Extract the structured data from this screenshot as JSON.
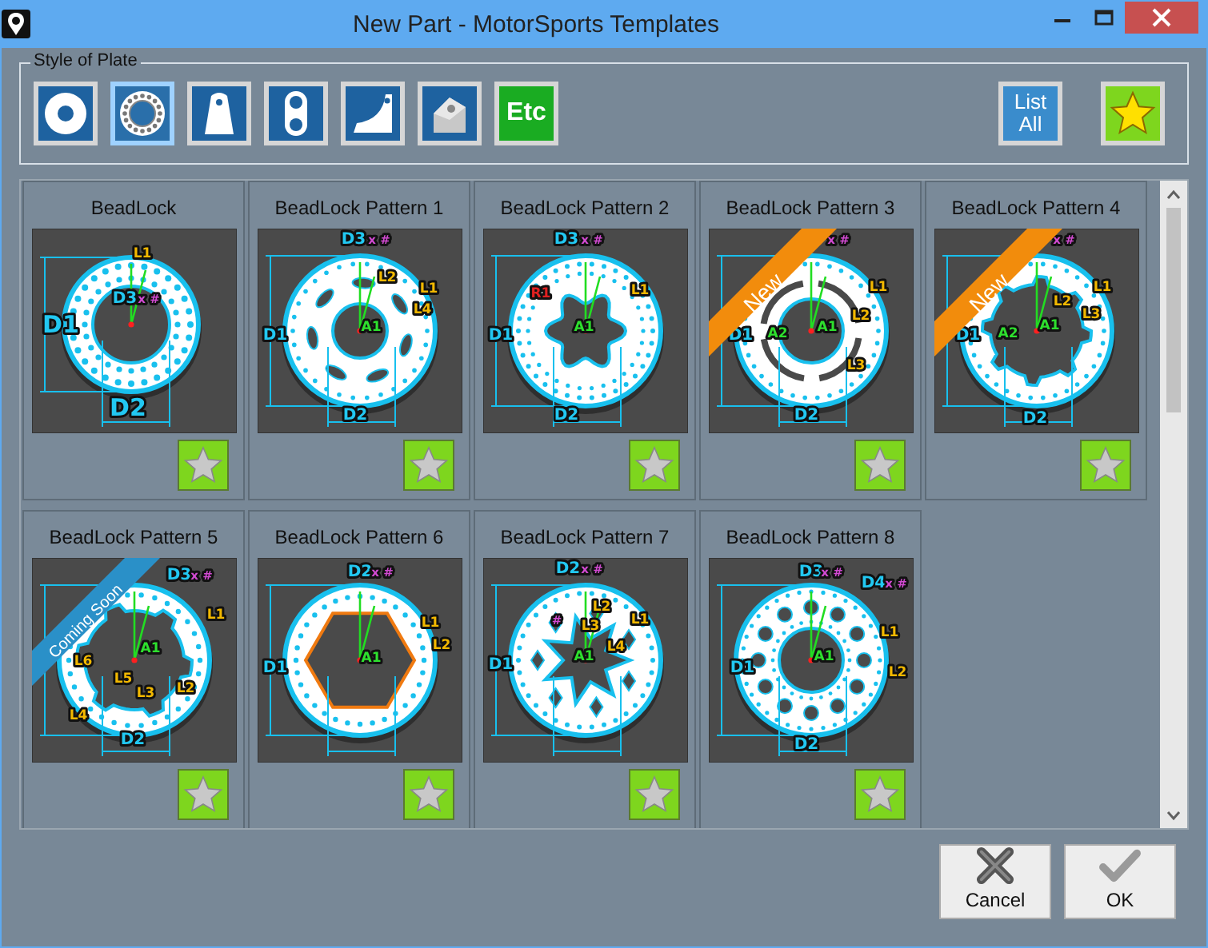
{
  "window": {
    "title": "New Part - MotorSports Templates"
  },
  "plate_style": {
    "label": "Style of Plate",
    "options": [
      {
        "kind": "washer",
        "selected": false
      },
      {
        "kind": "beadlock",
        "selected": true
      },
      {
        "kind": "tab",
        "selected": false
      },
      {
        "kind": "link",
        "selected": false
      },
      {
        "kind": "gusset",
        "selected": false
      },
      {
        "kind": "mount",
        "selected": false
      },
      {
        "kind": "text",
        "text": "Etc",
        "selected": false
      }
    ],
    "list_all": "List All"
  },
  "templates": [
    {
      "title": "BeadLock",
      "kind": "plain",
      "favorite": false,
      "labels": [
        {
          "text": "L1",
          "kind": "length"
        },
        {
          "text": "D3",
          "kind": "diameter"
        },
        {
          "text": "x #",
          "kind": "count"
        },
        {
          "text": "D1",
          "kind": "diameter"
        },
        {
          "text": "D2",
          "kind": "diameter"
        }
      ]
    },
    {
      "title": "BeadLock Pattern 1",
      "kind": "slots",
      "favorite": false,
      "labels": [
        {
          "text": "D3",
          "kind": "diameter"
        },
        {
          "text": "x #",
          "kind": "count"
        },
        {
          "text": "L2",
          "kind": "length"
        },
        {
          "text": "L1",
          "kind": "length"
        },
        {
          "text": "L4",
          "kind": "length"
        },
        {
          "text": "D1",
          "kind": "diameter"
        },
        {
          "text": "A1",
          "kind": "angle"
        },
        {
          "text": "D2",
          "kind": "diameter"
        }
      ]
    },
    {
      "title": "BeadLock Pattern 2",
      "kind": "lobes",
      "favorite": false,
      "labels": [
        {
          "text": "D3",
          "kind": "diameter"
        },
        {
          "text": "x #",
          "kind": "count"
        },
        {
          "text": "R1",
          "kind": "radius"
        },
        {
          "text": "L1",
          "kind": "length"
        },
        {
          "text": "D1",
          "kind": "diameter"
        },
        {
          "text": "A1",
          "kind": "angle"
        },
        {
          "text": "D2",
          "kind": "diameter"
        }
      ]
    },
    {
      "title": "BeadLock Pattern 3",
      "kind": "split",
      "favorite": false,
      "ribbon": {
        "kind": "new",
        "text": "New"
      },
      "labels": [
        {
          "text": "x #",
          "kind": "count"
        },
        {
          "text": "L1",
          "kind": "length"
        },
        {
          "text": "L2",
          "kind": "length"
        },
        {
          "text": "D1",
          "kind": "diameter"
        },
        {
          "text": "A2",
          "kind": "angle"
        },
        {
          "text": "A1",
          "kind": "angle"
        },
        {
          "text": "L3",
          "kind": "length"
        },
        {
          "text": "D2",
          "kind": "diameter"
        }
      ]
    },
    {
      "title": "BeadLock Pattern 4",
      "kind": "notches",
      "favorite": false,
      "ribbon": {
        "kind": "new",
        "text": "New"
      },
      "labels": [
        {
          "text": "x #",
          "kind": "count"
        },
        {
          "text": "L1",
          "kind": "length"
        },
        {
          "text": "L2",
          "kind": "length"
        },
        {
          "text": "L3",
          "kind": "length"
        },
        {
          "text": "D1",
          "kind": "diameter"
        },
        {
          "text": "A2",
          "kind": "angle"
        },
        {
          "text": "A1",
          "kind": "angle"
        },
        {
          "text": "D2",
          "kind": "diameter"
        }
      ]
    },
    {
      "title": "BeadLock Pattern 5",
      "kind": "cutouts",
      "favorite": false,
      "ribbon": {
        "kind": "soon",
        "text": "Coming Soon"
      },
      "labels": [
        {
          "text": "D3",
          "kind": "diameter"
        },
        {
          "text": "x #",
          "kind": "count"
        },
        {
          "text": "L1",
          "kind": "length"
        },
        {
          "text": "A1",
          "kind": "angle"
        },
        {
          "text": "L6",
          "kind": "length"
        },
        {
          "text": "L5",
          "kind": "length"
        },
        {
          "text": "L3",
          "kind": "length"
        },
        {
          "text": "L2",
          "kind": "length"
        },
        {
          "text": "L4",
          "kind": "length"
        },
        {
          "text": "D2",
          "kind": "diameter"
        }
      ]
    },
    {
      "title": "BeadLock Pattern 6",
      "kind": "hexagon",
      "favorite": false,
      "labels": [
        {
          "text": "D2",
          "kind": "diameter"
        },
        {
          "text": "x #",
          "kind": "count"
        },
        {
          "text": "L1",
          "kind": "length"
        },
        {
          "text": "L2",
          "kind": "length"
        },
        {
          "text": "D1",
          "kind": "diameter"
        },
        {
          "text": "A1",
          "kind": "angle"
        }
      ]
    },
    {
      "title": "BeadLock Pattern 7",
      "kind": "star",
      "favorite": false,
      "labels": [
        {
          "text": "D2",
          "kind": "diameter"
        },
        {
          "text": "x #",
          "kind": "count"
        },
        {
          "text": "#",
          "kind": "count"
        },
        {
          "text": "L2",
          "kind": "length"
        },
        {
          "text": "L3",
          "kind": "length"
        },
        {
          "text": "L1",
          "kind": "length"
        },
        {
          "text": "L4",
          "kind": "length"
        },
        {
          "text": "D1",
          "kind": "diameter"
        },
        {
          "text": "A1",
          "kind": "angle"
        }
      ]
    },
    {
      "title": "BeadLock Pattern 8",
      "kind": "holes",
      "favorite": false,
      "labels": [
        {
          "text": "D3",
          "kind": "diameter"
        },
        {
          "text": "x #",
          "kind": "count"
        },
        {
          "text": "D4",
          "kind": "diameter"
        },
        {
          "text": "x #",
          "kind": "count"
        },
        {
          "text": "L1",
          "kind": "length"
        },
        {
          "text": "D1",
          "kind": "diameter"
        },
        {
          "text": "A1",
          "kind": "angle"
        },
        {
          "text": "L2",
          "kind": "length"
        },
        {
          "text": "D2",
          "kind": "diameter"
        }
      ]
    }
  ],
  "buttons": [
    {
      "kind": "cancel",
      "label": "Cancel"
    },
    {
      "kind": "ok",
      "label": "OK"
    }
  ]
}
